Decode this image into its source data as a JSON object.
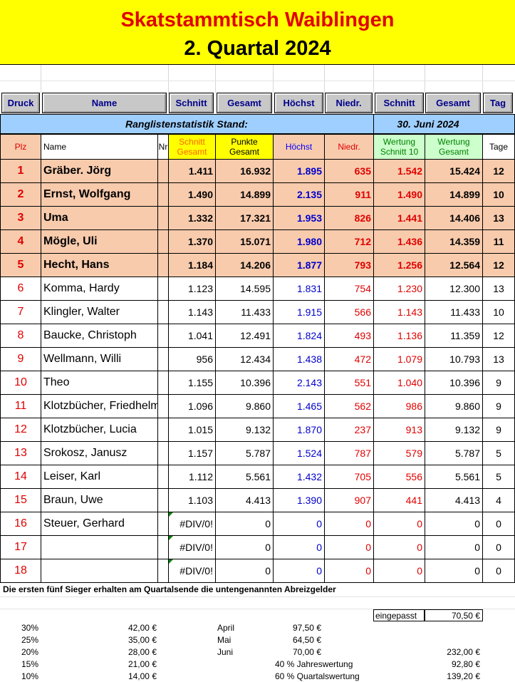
{
  "header": {
    "title": "Skatstammtisch Waiblingen",
    "subtitle": "2. Quartal 2024"
  },
  "buttons": [
    "Druck",
    "Name",
    "Schnitt",
    "Gesamt",
    "Höchst",
    "Niedr.",
    "Schnitt",
    "Gesamt",
    "Tag"
  ],
  "status": {
    "label": "Ranglistenstatistik Stand:",
    "date": "30. Juni 2024"
  },
  "columns": {
    "plz": "Plz",
    "name": "Name",
    "nr": "Nr",
    "schnitt_gesamt": [
      "Schnitt",
      "Gesamt"
    ],
    "punkte_gesamt": [
      "Punkte",
      "Gesamt"
    ],
    "hoechst": "Höchst",
    "niedr": "Niedr.",
    "wertung_schnitt": [
      "Wertung",
      "Schnitt 10"
    ],
    "wertung_gesamt": [
      "Wertung",
      "Gesamt"
    ],
    "tage": "Tage"
  },
  "rows": [
    {
      "plz": "1",
      "name": "Gräber. Jörg",
      "schnitt": "1.411",
      "punkte": "16.932",
      "hoechst": "1.895",
      "niedr": "635",
      "ws": "1.542",
      "wg": "15.424",
      "tage": "12"
    },
    {
      "plz": "2",
      "name": "Ernst, Wolfgang",
      "schnitt": "1.490",
      "punkte": "14.899",
      "hoechst": "2.135",
      "niedr": "911",
      "ws": "1.490",
      "wg": "14.899",
      "tage": "10"
    },
    {
      "plz": "3",
      "name": "Uma",
      "schnitt": "1.332",
      "punkte": "17.321",
      "hoechst": "1.953",
      "niedr": "826",
      "ws": "1.441",
      "wg": "14.406",
      "tage": "13"
    },
    {
      "plz": "4",
      "name": "Mögle, Uli",
      "schnitt": "1.370",
      "punkte": "15.071",
      "hoechst": "1.980",
      "niedr": "712",
      "ws": "1.436",
      "wg": "14.359",
      "tage": "11"
    },
    {
      "plz": "5",
      "name": "Hecht, Hans",
      "schnitt": "1.184",
      "punkte": "14.206",
      "hoechst": "1.877",
      "niedr": "793",
      "ws": "1.256",
      "wg": "12.564",
      "tage": "12"
    },
    {
      "plz": "6",
      "name": "Komma, Hardy",
      "schnitt": "1.123",
      "punkte": "14.595",
      "hoechst": "1.831",
      "niedr": "754",
      "ws": "1.230",
      "wg": "12.300",
      "tage": "13"
    },
    {
      "plz": "7",
      "name": "Klingler, Walter",
      "schnitt": "1.143",
      "punkte": "11.433",
      "hoechst": "1.915",
      "niedr": "566",
      "ws": "1.143",
      "wg": "11.433",
      "tage": "10"
    },
    {
      "plz": "8",
      "name": "Baucke, Christoph",
      "schnitt": "1.041",
      "punkte": "12.491",
      "hoechst": "1.824",
      "niedr": "493",
      "ws": "1.136",
      "wg": "11.359",
      "tage": "12"
    },
    {
      "plz": "9",
      "name": "Wellmann, Willi",
      "schnitt": "956",
      "punkte": "12.434",
      "hoechst": "1.438",
      "niedr": "472",
      "ws": "1.079",
      "wg": "10.793",
      "tage": "13"
    },
    {
      "plz": "10",
      "name": "Theo",
      "schnitt": "1.155",
      "punkte": "10.396",
      "hoechst": "2.143",
      "niedr": "551",
      "ws": "1.040",
      "wg": "10.396",
      "tage": "9"
    },
    {
      "plz": "11",
      "name": "Klotzbücher, Friedhelm",
      "schnitt": "1.096",
      "punkte": "9.860",
      "hoechst": "1.465",
      "niedr": "562",
      "ws": "986",
      "wg": "9.860",
      "tage": "9"
    },
    {
      "plz": "12",
      "name": "Klotzbücher, Lucia",
      "schnitt": "1.015",
      "punkte": "9.132",
      "hoechst": "1.870",
      "niedr": "237",
      "ws": "913",
      "wg": "9.132",
      "tage": "9"
    },
    {
      "plz": "13",
      "name": "Srokosz, Janusz",
      "schnitt": "1.157",
      "punkte": "5.787",
      "hoechst": "1.524",
      "niedr": "787",
      "ws": "579",
      "wg": "5.787",
      "tage": "5"
    },
    {
      "plz": "14",
      "name": "Leiser, Karl",
      "schnitt": "1.112",
      "punkte": "5.561",
      "hoechst": "1.432",
      "niedr": "705",
      "ws": "556",
      "wg": "5.561",
      "tage": "5"
    },
    {
      "plz": "15",
      "name": "Braun, Uwe",
      "schnitt": "1.103",
      "punkte": "4.413",
      "hoechst": "1.390",
      "niedr": "907",
      "ws": "441",
      "wg": "4.413",
      "tage": "4"
    },
    {
      "plz": "16",
      "name": "Steuer, Gerhard",
      "schnitt": "#DIV/0!",
      "punkte": "0",
      "hoechst": "0",
      "niedr": "0",
      "ws": "0",
      "wg": "0",
      "tage": "0"
    },
    {
      "plz": "17",
      "name": "",
      "schnitt": "#DIV/0!",
      "punkte": "0",
      "hoechst": "0",
      "niedr": "0",
      "ws": "0",
      "wg": "0",
      "tage": "0"
    },
    {
      "plz": "18",
      "name": "",
      "schnitt": "#DIV/0!",
      "punkte": "0",
      "hoechst": "0",
      "niedr": "0",
      "ws": "0",
      "wg": "0",
      "tage": "0"
    }
  ],
  "prize": {
    "note": "Die ersten fünf Sieger erhalten am Quartalsende die untengenannten Abreizgelder",
    "eingepasst_label": "eingepasst",
    "eingepasst_value": "70,50 €",
    "percents": [
      "30%",
      "25%",
      "20%",
      "15%",
      "10%"
    ],
    "amounts": [
      "42,00 €",
      "35,00 €",
      "28,00 €",
      "21,00 €",
      "14,00 €"
    ],
    "months": [
      {
        "label": "April",
        "value": "97,50 €"
      },
      {
        "label": "Mai",
        "value": "64,50 €"
      },
      {
        "label": "Juni",
        "value": "70,00 €"
      }
    ],
    "total": "232,00 €",
    "jahres_label": "40 % Jahreswertung",
    "jahres_value": "92,80 €",
    "quartal_label": "60 % Quartalswertung",
    "quartal_value": "139,20 €"
  }
}
